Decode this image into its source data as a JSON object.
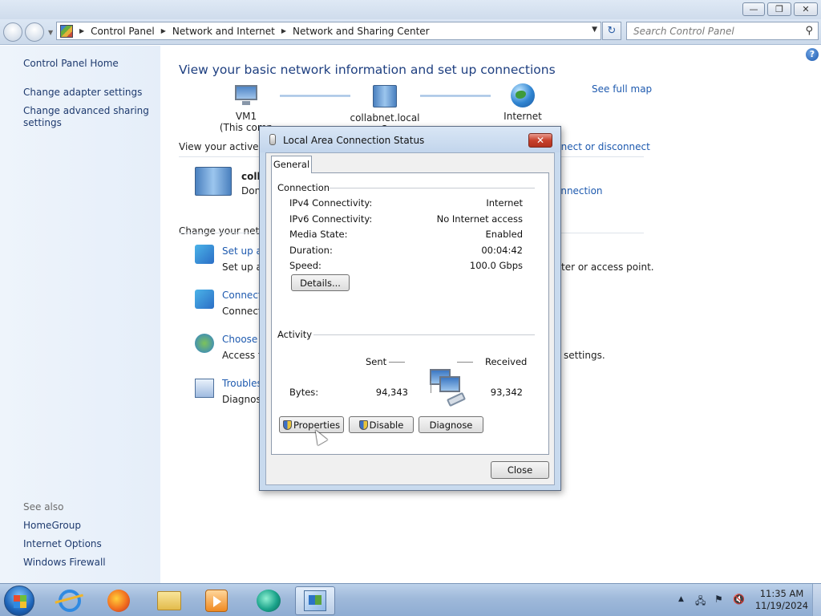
{
  "window": {
    "minimize_glyph": "—",
    "maximize_glyph": "❐",
    "close_glyph": "✕"
  },
  "address_bar": {
    "crumbs": [
      "Control Panel",
      "Network and Internet",
      "Network and Sharing Center"
    ],
    "refresh_glyph": "↻",
    "search_placeholder": "Search Control Panel",
    "search_glyph": "⚲"
  },
  "left_nav": {
    "home": "Control Panel Home",
    "adapter": "Change adapter settings",
    "advanced_line1": "Change advanced sharing",
    "advanced_line2": "settings",
    "see_also": "See also",
    "homegroup": "HomeGroup",
    "internet_options": "Internet Options",
    "firewall": "Windows Firewall"
  },
  "main": {
    "help_glyph": "?",
    "heading": "View your basic network information and set up connections",
    "node_pc": "VM1",
    "node_pc_sub": "(This comp",
    "node_network": "collabnet.local  3",
    "node_internet": "Internet",
    "see_full_map": "See full map",
    "active_networks": "View your active ne",
    "connect_disconnect": "nnect or disconnect",
    "network_name": "colla",
    "network_sub": "Don",
    "connection_link": "onnection",
    "change_settings": "Change your netwo",
    "task1_link": "Set up a",
    "task1_desc": "Set up a",
    "task1_tail": "ter or access point.",
    "task2_link": "Connect",
    "task2_desc": "Connect",
    "task3_link": "Choose",
    "task3_desc": "Access fi",
    "task3_tail": "settings.",
    "task4_link": "Troubles",
    "task4_desc": "Diagnose"
  },
  "dialog": {
    "title": "Local Area Connection Status",
    "close_glyph": "✕",
    "tab": "General",
    "connection_group": "Connection",
    "rows": [
      {
        "label": "IPv4 Connectivity:",
        "value": "Internet"
      },
      {
        "label": "IPv6 Connectivity:",
        "value": "No Internet access"
      },
      {
        "label": "Media State:",
        "value": "Enabled"
      },
      {
        "label": "Duration:",
        "value": "00:04:42"
      },
      {
        "label": "Speed:",
        "value": "100.0 Gbps"
      }
    ],
    "details_button": "Details...",
    "activity_group": "Activity",
    "sent_label": "Sent",
    "received_label": "Received",
    "bytes_label": "Bytes:",
    "bytes_sent": "94,343",
    "bytes_received": "93,342",
    "properties_button": "Properties",
    "disable_button": "Disable",
    "diagnose_button": "Diagnose",
    "close_button": "Close"
  },
  "taskbar": {
    "tray_arrow": "▲",
    "tray_flag": "⚑",
    "tray_volume": "🔇",
    "tray_network": "🖧",
    "time": "11:35 AM",
    "date": "11/19/2024"
  }
}
